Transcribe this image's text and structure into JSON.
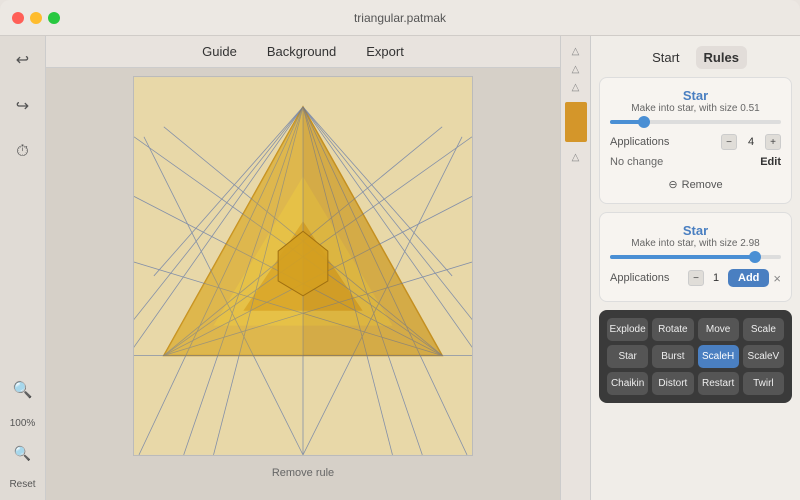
{
  "titlebar": {
    "title": "triangular.patmak"
  },
  "sidebar": {
    "icons": [
      "↩",
      "↪",
      "⏱"
    ],
    "zoom": "100%",
    "reset": "Reset"
  },
  "toolbar": {
    "items": [
      "Guide",
      "Background",
      "Export"
    ]
  },
  "canvas": {
    "caption": "Remove rule"
  },
  "tabs": {
    "start": "Start",
    "rules": "Rules",
    "active": "rules"
  },
  "rule1": {
    "title": "Star",
    "desc": "Make into star, with size 0.51",
    "slider_pct": 20,
    "thumb_pct": 20,
    "apps_label": "Applications",
    "apps_value": "4",
    "nochange": "No change",
    "edit": "Edit",
    "remove": "Remove"
  },
  "rule2": {
    "title": "Star",
    "desc": "Make into star, with size 2.98",
    "slider_pct": 85,
    "thumb_pct": 85,
    "apps_label": "Applications",
    "apps_value": "1",
    "add": "Add",
    "close": "×"
  },
  "grid": {
    "buttons": [
      "Explode",
      "Rotate",
      "Move",
      "Scale",
      "Star",
      "Burst",
      "ScaleH",
      "ScaleV",
      "Chaikin",
      "Distort",
      "Restart",
      "Twirl"
    ],
    "active": "ScaleH"
  }
}
